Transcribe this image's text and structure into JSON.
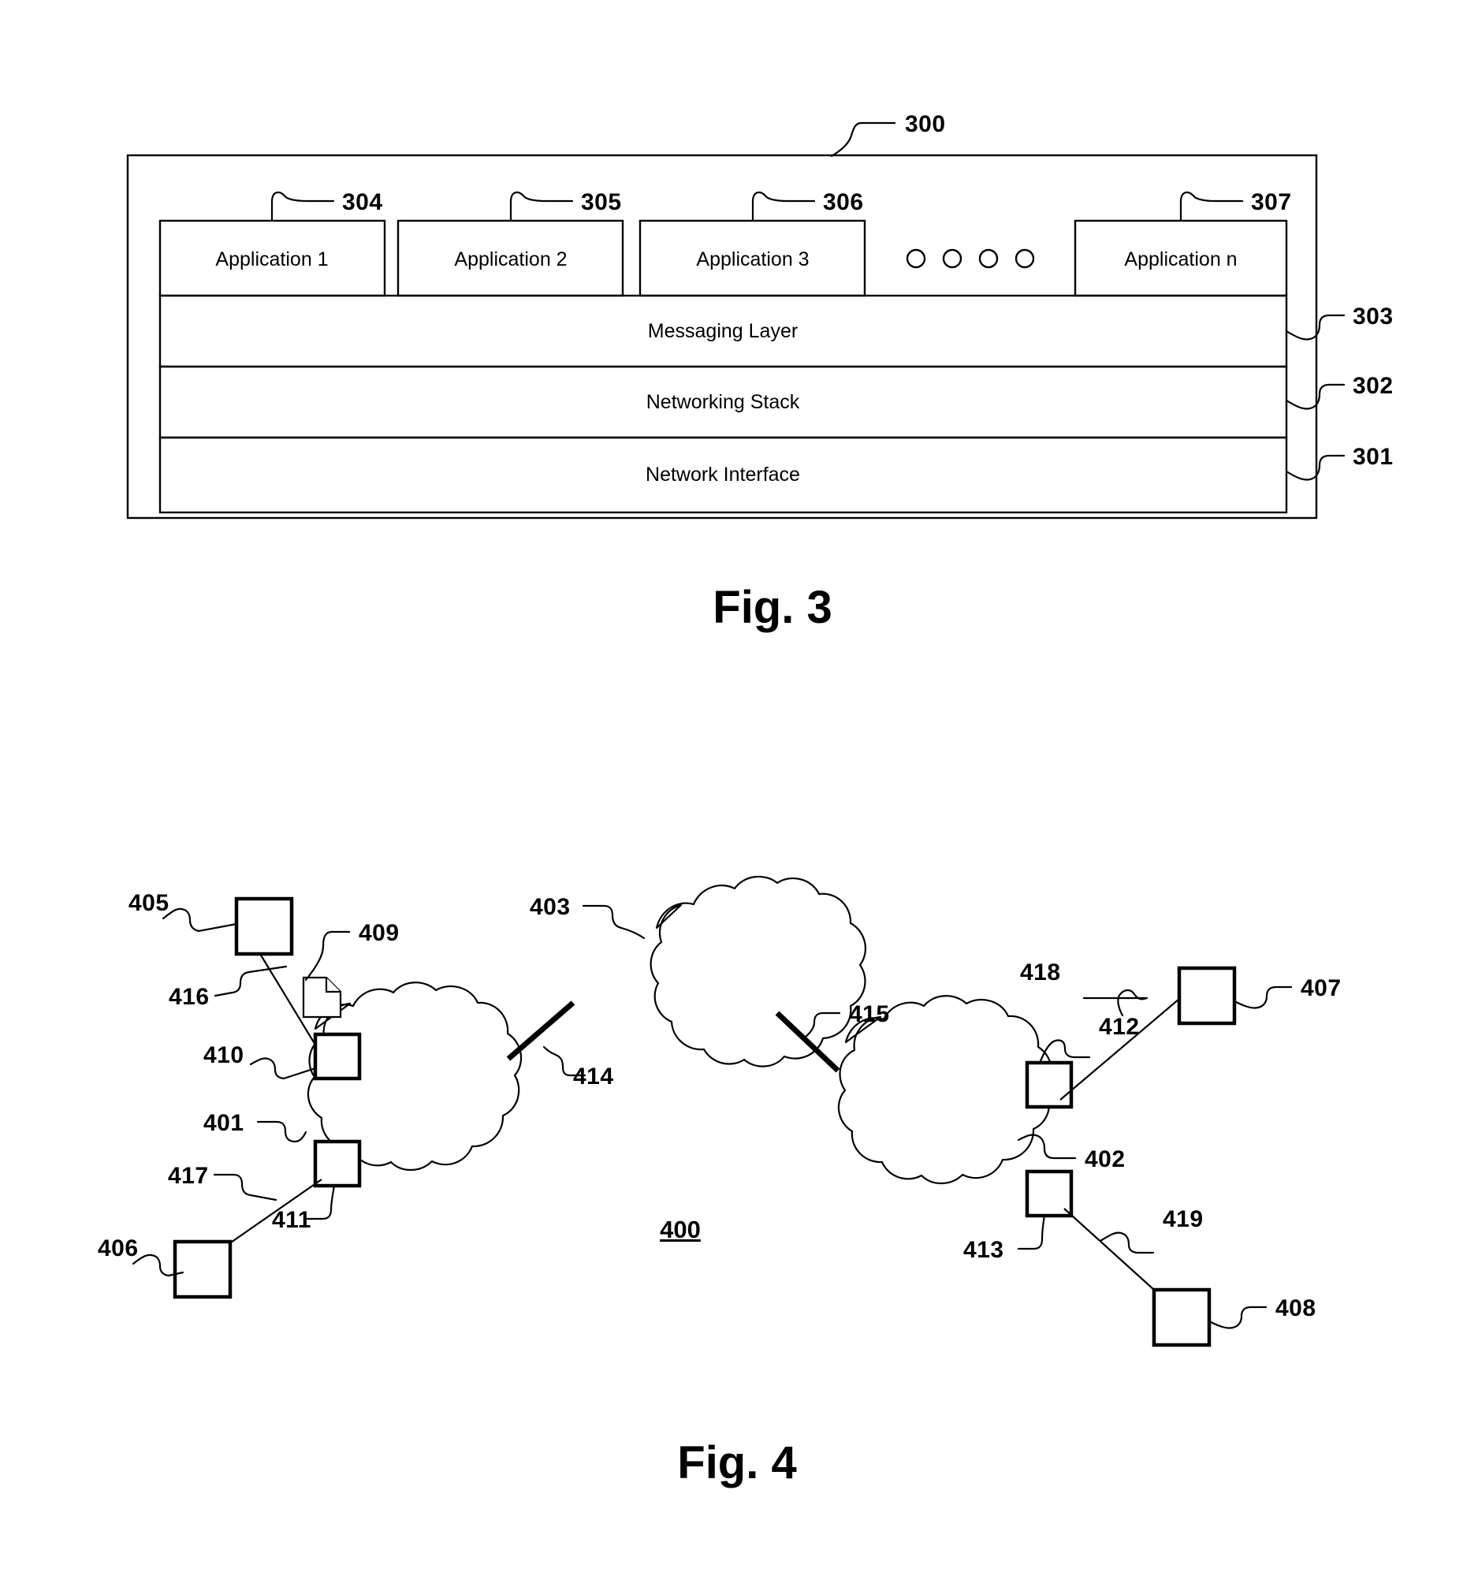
{
  "figure3": {
    "caption": "Fig. 3",
    "system_ref": "300",
    "applications": [
      {
        "label": "Application 1",
        "ref": "304"
      },
      {
        "label": "Application 2",
        "ref": "305"
      },
      {
        "label": "Application 3",
        "ref": "306"
      },
      {
        "label": "Application n",
        "ref": "307"
      }
    ],
    "ellipsis_dots": 4,
    "layers": [
      {
        "label": "Messaging Layer",
        "ref": "303"
      },
      {
        "label": "Networking Stack",
        "ref": "302"
      },
      {
        "label": "Network Interface",
        "ref": "301"
      }
    ]
  },
  "figure4": {
    "caption": "Fig. 4",
    "system_ref": "400",
    "clouds": [
      {
        "ref": "401",
        "name": "left-network-cloud"
      },
      {
        "ref": "402",
        "name": "right-network-cloud"
      },
      {
        "ref": "403",
        "name": "center-network-cloud"
      }
    ],
    "endpoints": [
      {
        "ref": "405",
        "name": "top-left-endpoint"
      },
      {
        "ref": "406",
        "name": "bottom-left-endpoint"
      },
      {
        "ref": "407",
        "name": "top-right-endpoint"
      },
      {
        "ref": "408",
        "name": "bottom-right-endpoint"
      }
    ],
    "gateways": [
      {
        "ref": "410",
        "name": "left-upper-gateway"
      },
      {
        "ref": "411",
        "name": "left-lower-gateway"
      },
      {
        "ref": "412",
        "name": "right-upper-gateway"
      },
      {
        "ref": "413",
        "name": "right-lower-gateway"
      }
    ],
    "links": [
      {
        "ref": "414",
        "name": "left-to-center-trunk-link"
      },
      {
        "ref": "415",
        "name": "center-to-right-trunk-link"
      },
      {
        "ref": "416",
        "name": "endpoint-405-to-gateway-410-link"
      },
      {
        "ref": "417",
        "name": "endpoint-406-to-gateway-411-link"
      },
      {
        "ref": "418",
        "name": "gateway-412-to-endpoint-407-link"
      },
      {
        "ref": "419",
        "name": "gateway-413-to-endpoint-408-link"
      }
    ],
    "message": {
      "ref": "409",
      "name": "message-document"
    }
  }
}
